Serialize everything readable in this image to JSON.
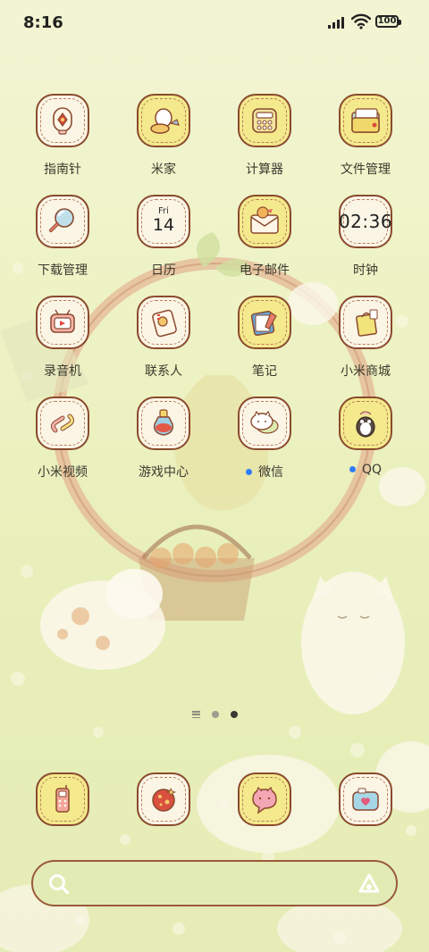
{
  "status_bar": {
    "time": "8:16",
    "battery": "100"
  },
  "apps": [
    {
      "label": "指南针",
      "icon": "compass-icon"
    },
    {
      "label": "米家",
      "icon": "mijia-icon"
    },
    {
      "label": "计算器",
      "icon": "calculator-icon"
    },
    {
      "label": "文件管理",
      "icon": "file-manager-icon"
    },
    {
      "label": "下载管理",
      "icon": "download-manager-icon"
    },
    {
      "label": "日历",
      "icon": "calendar-icon",
      "weekday": "Fri",
      "day": "14"
    },
    {
      "label": "电子邮件",
      "icon": "email-icon"
    },
    {
      "label": "时钟",
      "icon": "clock-icon",
      "clock_text": "02:36"
    },
    {
      "label": "录音机",
      "icon": "recorder-icon"
    },
    {
      "label": "联系人",
      "icon": "contacts-icon"
    },
    {
      "label": "笔记",
      "icon": "notes-icon"
    },
    {
      "label": "小米商城",
      "icon": "mi-store-icon"
    },
    {
      "label": "小米视频",
      "icon": "mi-video-icon"
    },
    {
      "label": "游戏中心",
      "icon": "game-center-icon"
    },
    {
      "label": "微信",
      "icon": "wechat-icon",
      "new_badge": true
    },
    {
      "label": "QQ",
      "icon": "qq-icon",
      "new_badge": true
    }
  ],
  "dock": [
    {
      "icon": "phone-icon"
    },
    {
      "icon": "browser-icon"
    },
    {
      "icon": "messages-icon"
    },
    {
      "icon": "camera-icon"
    }
  ],
  "pager": {
    "page_count": 2,
    "active_page": 2
  },
  "colors": {
    "badge": "#2f7cf6",
    "icon_border": "#8a4a2e",
    "wallpaper": "#eef3c9"
  }
}
